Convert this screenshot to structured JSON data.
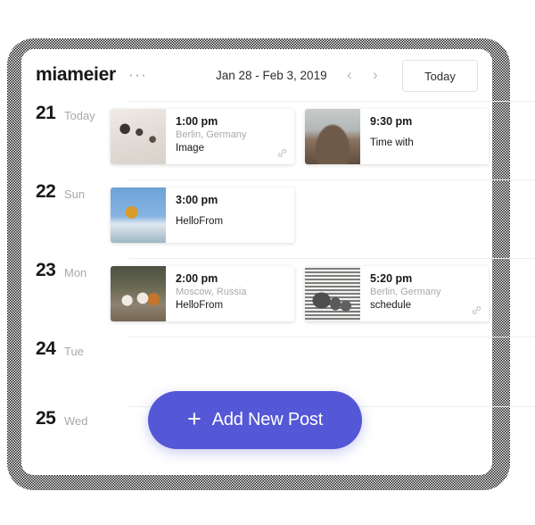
{
  "header": {
    "brand": "miameier",
    "more_icon": "···",
    "date_range": "Jan 28 - Feb 3, 2019",
    "prev_label": "‹",
    "next_label": "›",
    "today_label": "Today"
  },
  "colors": {
    "accent": "#5457d6",
    "text": "#17181a",
    "muted": "#a7a9ad",
    "divider": "#ededee",
    "card_bg": "#ffffff"
  },
  "fab": {
    "plus": "+",
    "label": "Add New Post"
  },
  "days": [
    {
      "number": "21",
      "name": "Today",
      "events": [
        {
          "time": "1:00 pm",
          "place": "Berlin, Germany",
          "title": "Image",
          "has_link": true,
          "thumb": "thumb-a",
          "thumb_name": "event-thumbnail-women-in-bed"
        },
        {
          "time": "9:30 pm",
          "place": "",
          "title": "Time with",
          "has_link": false,
          "thumb": "thumb-b",
          "thumb_name": "event-thumbnail-person-on-rocks"
        }
      ]
    },
    {
      "number": "22",
      "name": "Sun",
      "events": [
        {
          "time": "3:00 pm",
          "place": "",
          "title": "HelloFrom",
          "has_link": false,
          "thumb": "thumb-c",
          "thumb_name": "event-thumbnail-diver"
        }
      ]
    },
    {
      "number": "23",
      "name": "Mon",
      "events": [
        {
          "time": "2:00 pm",
          "place": "Moscow, Russia",
          "title": "HelloFrom",
          "has_link": false,
          "thumb": "thumb-d",
          "thumb_name": "event-thumbnail-dogs"
        },
        {
          "time": "5:20 pm",
          "place": "Berlin, Germany",
          "title": "schedule",
          "has_link": true,
          "thumb": "thumb-e",
          "thumb_name": "event-thumbnail-striped-shirts"
        }
      ]
    },
    {
      "number": "24",
      "name": "Tue",
      "events": []
    },
    {
      "number": "25",
      "name": "Wed",
      "events": []
    }
  ]
}
